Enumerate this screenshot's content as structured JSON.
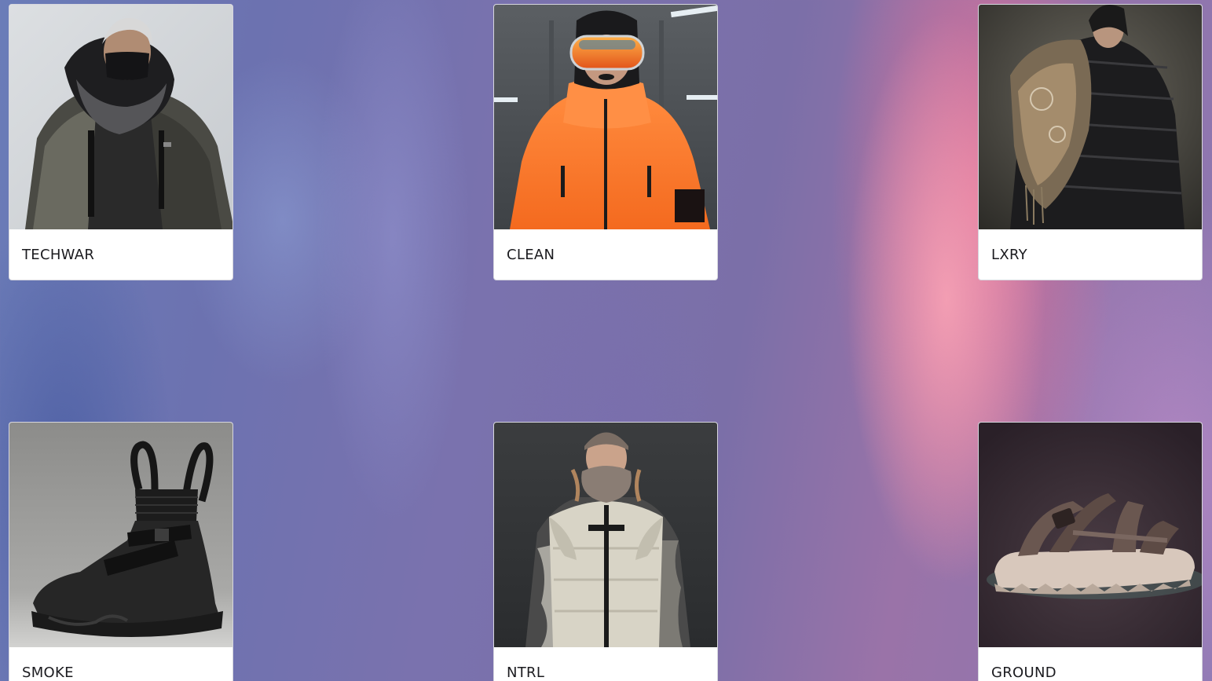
{
  "categories": [
    {
      "label": "TECHWAR",
      "image": "person-in-black-techwear-hood-and-mask"
    },
    {
      "label": "CLEAN",
      "image": "person-in-orange-jacket-with-ski-goggles"
    },
    {
      "label": "LXRY",
      "image": "person-in-black-puffer-with-patterned-scarf"
    },
    {
      "label": "SMOKE",
      "image": "black-strapped-high-top-sneaker"
    },
    {
      "label": "NTRL",
      "image": "person-in-cream-puffer-vest-and-beanie"
    },
    {
      "label": "GROUND",
      "image": "taupe-strapped-sandal"
    }
  ]
}
